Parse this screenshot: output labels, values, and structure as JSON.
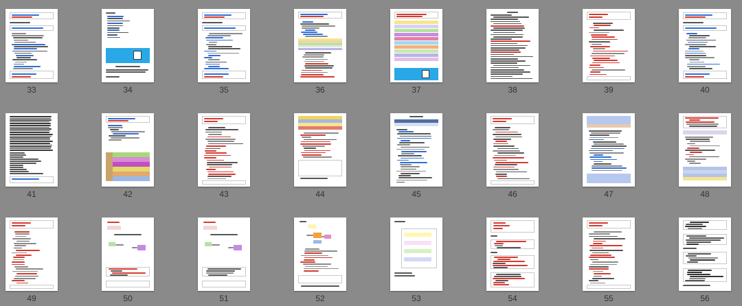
{
  "viewer": {
    "background_color": "#8a8a8a",
    "page_color": "#ffffff",
    "rows": [
      {
        "pages": [
          {
            "number": "33",
            "style": "code-blue"
          },
          {
            "number": "34",
            "style": "text-banner"
          },
          {
            "number": "35",
            "style": "code-blue"
          },
          {
            "number": "36",
            "style": "table-colored"
          },
          {
            "number": "37",
            "style": "colored-table-banner"
          },
          {
            "number": "38",
            "style": "text-dense"
          },
          {
            "number": "39",
            "style": "code-red"
          },
          {
            "number": "40",
            "style": "code-blue"
          }
        ]
      },
      {
        "pages": [
          {
            "number": "41",
            "style": "text-very-dense"
          },
          {
            "number": "42",
            "style": "color-blocks"
          },
          {
            "number": "43",
            "style": "code-red"
          },
          {
            "number": "44",
            "style": "table-colored-top"
          },
          {
            "number": "45",
            "style": "code-blue-table"
          },
          {
            "number": "46",
            "style": "code-red"
          },
          {
            "number": "47",
            "style": "blue-boxes"
          },
          {
            "number": "48",
            "style": "code-red-table"
          }
        ]
      },
      {
        "pages": [
          {
            "number": "49",
            "style": "code-red"
          },
          {
            "number": "50",
            "style": "diagram"
          },
          {
            "number": "51",
            "style": "diagram"
          },
          {
            "number": "52",
            "style": "diagram-color"
          },
          {
            "number": "53",
            "style": "flowchart"
          },
          {
            "number": "54",
            "style": "code-red-list"
          },
          {
            "number": "55",
            "style": "code-red"
          },
          {
            "number": "56",
            "style": "code-dark"
          }
        ]
      }
    ],
    "colors": {
      "code_blue": "#2f6fd6",
      "code_red": "#d43a2f",
      "text_dark": "#555555",
      "banner_blue": "#29a8e8",
      "yellow": "#f6e58d",
      "purple": "#c48be0",
      "green": "#b6e3a0",
      "orange": "#f3b07a",
      "pink": "#e57fa8",
      "lilac": "#b9b4e6"
    }
  }
}
